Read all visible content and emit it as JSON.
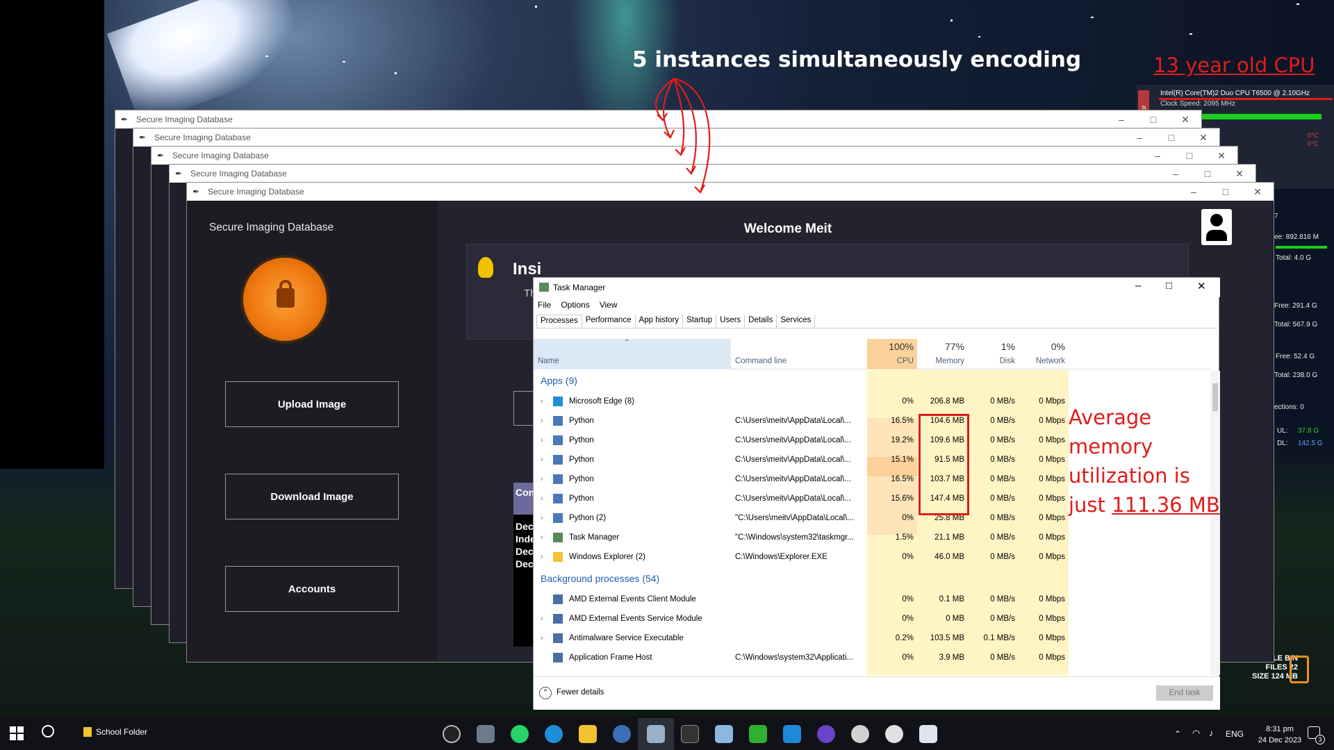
{
  "annotations": {
    "instances_text": "5 instances simultaneously encoding",
    "cpu_text": "13 year old CPU",
    "memory_note": [
      "Average",
      "memory",
      "utilization is",
      "just "
    ],
    "memory_value": "111.36 MB"
  },
  "sysmon": {
    "label": "nitor",
    "cpu_name": "Intel(R) Core(TM)2 Duo CPU     T6500  @ 2.10GHz",
    "clock": "Clock Speed: 2095 MHz",
    "temp1": "0°C",
    "temp2": "0°C",
    "ram_free": "ee: 892.816 M",
    "ram_total": "Total: 4.0 G",
    "d1_free": "Free: 291.4 G",
    "d1_total": "Total: 567.9 G",
    "d2_free": "Free: 52.4 G",
    "d2_total": "Total: 238.0 G",
    "connections": "ections: 0",
    "ul_label": "UL:",
    "ul_val": "37.8 G",
    "dl_label": "DL:",
    "dl_val": "142.5 G",
    "num7": "7"
  },
  "recycle": {
    "line1": "CYCLE BIN",
    "line2": "FILES 22",
    "line3": "SIZE  124 MB"
  },
  "app": {
    "window_title": "Secure Imaging Database",
    "sidebar_title": "Secure Imaging Database",
    "welcome": "Welcome Meit",
    "insight_heading": "Insi",
    "insight_sub": "Th",
    "btn_upload": "Upload Image",
    "btn_download": "Download Image",
    "btn_accounts": "Accounts",
    "behind_label": "Con",
    "behind_lines": [
      "Dec",
      "Inde",
      "Dec",
      "Dec"
    ]
  },
  "taskmgr": {
    "title": "Task Manager",
    "menu": [
      "File",
      "Options",
      "View"
    ],
    "tabs": [
      "Processes",
      "Performance",
      "App history",
      "Startup",
      "Users",
      "Details",
      "Services"
    ],
    "columns": {
      "name": "Name",
      "cmd": "Command line",
      "cpu_pct": "100%",
      "cpu": "CPU",
      "mem_pct": "77%",
      "mem": "Memory",
      "disk_pct": "1%",
      "disk": "Disk",
      "net_pct": "0%",
      "net": "Network"
    },
    "apps_header": "Apps (9)",
    "bg_header": "Background processes (54)",
    "apps": [
      {
        "name": "Microsoft Edge (8)",
        "cmd": "",
        "cpu": "0%",
        "mem": "206.8 MB",
        "disk": "0 MB/s",
        "net": "0 Mbps",
        "icon": "edge-icon",
        "color": "#1f8ed8"
      },
      {
        "name": "Python",
        "cmd": "C:\\Users\\meitv\\AppData\\Local\\...",
        "cpu": "16.5%",
        "mem": "104.6 MB",
        "disk": "0 MB/s",
        "net": "0 Mbps",
        "icon": "python-window-icon",
        "color": "#4a78b8"
      },
      {
        "name": "Python",
        "cmd": "C:\\Users\\meitv\\AppData\\Local\\...",
        "cpu": "19.2%",
        "mem": "109.6 MB",
        "disk": "0 MB/s",
        "net": "0 Mbps",
        "icon": "python-window-icon",
        "color": "#4a78b8"
      },
      {
        "name": "Python",
        "cmd": "C:\\Users\\meitv\\AppData\\Local\\...",
        "cpu": "15.1%",
        "mem": "91.5 MB",
        "disk": "0 MB/s",
        "net": "0 Mbps",
        "icon": "python-window-icon",
        "color": "#4a78b8"
      },
      {
        "name": "Python",
        "cmd": "C:\\Users\\meitv\\AppData\\Local\\...",
        "cpu": "16.5%",
        "mem": "103.7 MB",
        "disk": "0 MB/s",
        "net": "0 Mbps",
        "icon": "python-window-icon",
        "color": "#4a78b8"
      },
      {
        "name": "Python",
        "cmd": "C:\\Users\\meitv\\AppData\\Local\\...",
        "cpu": "15.6%",
        "mem": "147.4 MB",
        "disk": "0 MB/s",
        "net": "0 Mbps",
        "icon": "python-window-icon",
        "color": "#4a78b8"
      },
      {
        "name": "Python (2)",
        "cmd": "\"C:\\Users\\meitv\\AppData\\Local\\...",
        "cpu": "0%",
        "mem": "25.8 MB",
        "disk": "0 MB/s",
        "net": "0 Mbps",
        "icon": "python-window-icon",
        "color": "#4a78b8"
      },
      {
        "name": "Task Manager",
        "cmd": "\"C:\\Windows\\system32\\taskmgr...",
        "cpu": "1.5%",
        "mem": "21.1 MB",
        "disk": "0 MB/s",
        "net": "0 Mbps",
        "icon": "task-manager-icon",
        "color": "#5a8a5a"
      },
      {
        "name": "Windows Explorer (2)",
        "cmd": "C:\\Windows\\Explorer.EXE",
        "cpu": "0%",
        "mem": "46.0 MB",
        "disk": "0 MB/s",
        "net": "0 Mbps",
        "icon": "folder-icon",
        "color": "#f2c230"
      }
    ],
    "background": [
      {
        "name": "AMD External Events Client Module",
        "cmd": "",
        "cpu": "0%",
        "mem": "0.1 MB",
        "disk": "0 MB/s",
        "net": "0 Mbps",
        "icon": "service-icon",
        "color": "#4a6fa5"
      },
      {
        "name": "AMD External Events Service Module",
        "cmd": "",
        "cpu": "0%",
        "mem": "0 MB",
        "disk": "0 MB/s",
        "net": "0 Mbps",
        "icon": "service-icon",
        "color": "#4a6fa5"
      },
      {
        "name": "Antimalware Service Executable",
        "cmd": "",
        "cpu": "0.2%",
        "mem": "103.5 MB",
        "disk": "0.1 MB/s",
        "net": "0 Mbps",
        "icon": "service-icon",
        "color": "#4a6fa5"
      },
      {
        "name": "Application Frame Host",
        "cmd": "C:\\Windows\\system32\\Applicati...",
        "cpu": "0%",
        "mem": "3.9 MB",
        "disk": "0 MB/s",
        "net": "0 Mbps",
        "icon": "service-icon",
        "color": "#4a6fa5"
      }
    ],
    "fewer_details": "Fewer details",
    "end_task": "End task"
  },
  "taskbar": {
    "folder_label": "School Folder",
    "lang": "ENG",
    "time": "8:31 pm",
    "date": "24 Dec 2023",
    "notif_count": "3"
  },
  "colors": {
    "annotation_red": "#e11c1c",
    "cpu_heat_high": "#fcd29a",
    "cpu_heat_low": "#fff4c4",
    "accent_orange": "#f5901e"
  }
}
